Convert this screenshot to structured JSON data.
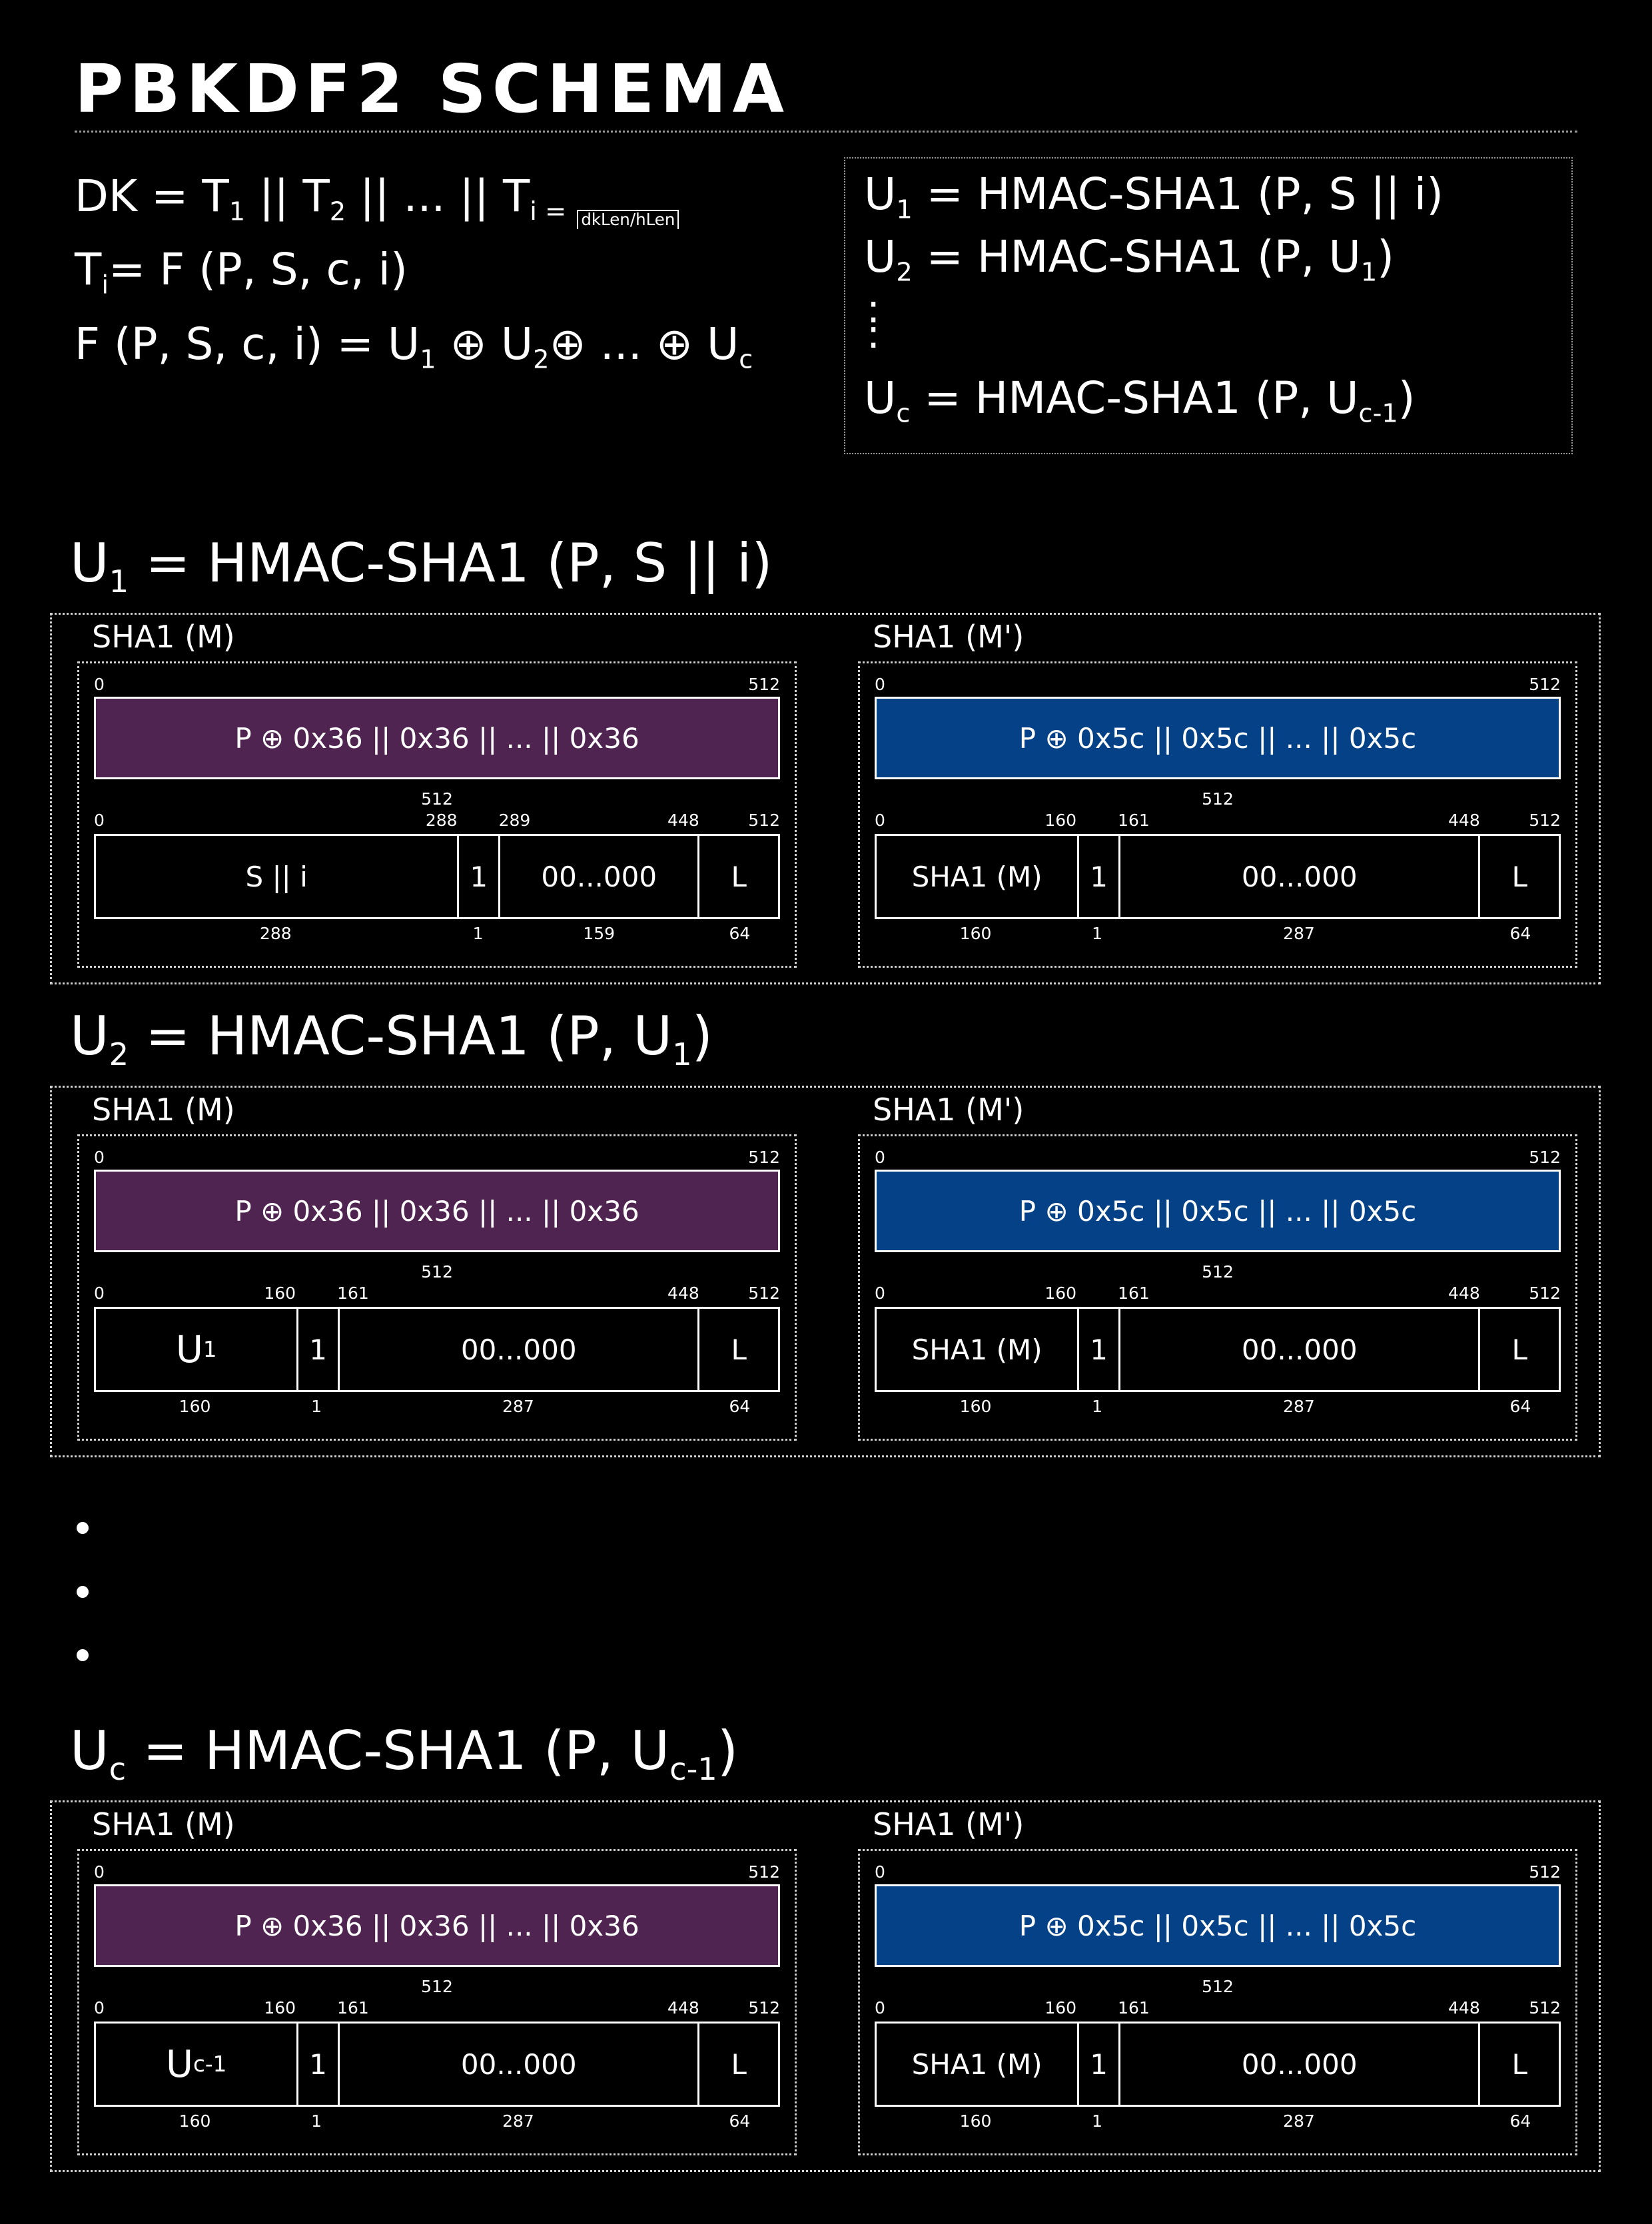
{
  "title": "PBKDF2 SCHEMA",
  "formulas": {
    "dk": {
      "lhs": "DK = T",
      "s1": "1",
      "m1": " || T",
      "s2": "2",
      "m2": " || ... || T",
      "s3": "i = ",
      "ceil": "dkLen/hLen"
    },
    "ti": {
      "a": "T",
      "s1": "i",
      "b": "= F (P, S, c, i)"
    },
    "f": {
      "a": "F (P, S, c, i) = U",
      "s1": "1",
      "b": " ⊕  U",
      "s2": "2",
      "c": "⊕ ... ⊕ U",
      "s3": "c"
    }
  },
  "u_box": {
    "line1": {
      "a": "U",
      "s": "1",
      "b": " = HMAC-SHA1 (P, S || i)"
    },
    "line2": {
      "a": "U",
      "s": "2",
      "b": " = HMAC-SHA1 (P, U",
      "s2": "1",
      "c": ")"
    },
    "dots": ":",
    "line3": {
      "a": "U",
      "s": "c",
      "b": " = HMAC-SHA1 (P, U",
      "s2": "c-1",
      "c": ")"
    }
  },
  "sections": [
    {
      "heading": {
        "a": "U",
        "s": "1",
        "b": " = HMAC-SHA1 (P, S || i)",
        "s2": "",
        "c": ""
      },
      "left": {
        "title": "SHA1 (M)",
        "bar_text": "P ⊕ 0x36 || 0x36 || ... || 0x36",
        "bar_start": "0",
        "bar_end": "512",
        "bar_len": "512",
        "top_ticks": [
          "0",
          "288",
          "289",
          "448",
          "512"
        ],
        "segments": [
          {
            "text": "S || i",
            "sub": ""
          },
          {
            "text": "1",
            "sub": ""
          },
          {
            "text": "00...000",
            "sub": ""
          },
          {
            "text": "L",
            "sub": ""
          }
        ],
        "widths": [
          "288",
          "1",
          "159",
          "64"
        ]
      },
      "right": {
        "title": "SHA1 (M')",
        "bar_text": "P ⊕ 0x5c || 0x5c || ... || 0x5c",
        "bar_start": "0",
        "bar_end": "512",
        "bar_len": "512",
        "top_ticks": [
          "0",
          "160",
          "161",
          "448",
          "512"
        ],
        "segments": [
          {
            "text": "SHA1 (M)",
            "sub": ""
          },
          {
            "text": "1",
            "sub": ""
          },
          {
            "text": "00...000",
            "sub": ""
          },
          {
            "text": "L",
            "sub": ""
          }
        ],
        "widths": [
          "160",
          "1",
          "287",
          "64"
        ]
      }
    },
    {
      "heading": {
        "a": "U",
        "s": "2",
        "b": " = HMAC-SHA1 (P, U",
        "s2": "1",
        "c": ")"
      },
      "left": {
        "title": "SHA1 (M)",
        "bar_text": "P ⊕ 0x36 || 0x36 || ... || 0x36",
        "bar_start": "0",
        "bar_end": "512",
        "bar_len": "512",
        "top_ticks": [
          "0",
          "160",
          "161",
          "448",
          "512"
        ],
        "segments": [
          {
            "text": "U",
            "sub": "1"
          },
          {
            "text": "1",
            "sub": ""
          },
          {
            "text": "00...000",
            "sub": ""
          },
          {
            "text": "L",
            "sub": ""
          }
        ],
        "widths": [
          "160",
          "1",
          "287",
          "64"
        ]
      },
      "right": {
        "title": "SHA1 (M')",
        "bar_text": "P ⊕ 0x5c || 0x5c || ... || 0x5c",
        "bar_start": "0",
        "bar_end": "512",
        "bar_len": "512",
        "top_ticks": [
          "0",
          "160",
          "161",
          "448",
          "512"
        ],
        "segments": [
          {
            "text": "SHA1 (M)",
            "sub": ""
          },
          {
            "text": "1",
            "sub": ""
          },
          {
            "text": "00...000",
            "sub": ""
          },
          {
            "text": "L",
            "sub": ""
          }
        ],
        "widths": [
          "160",
          "1",
          "287",
          "64"
        ]
      }
    },
    {
      "heading": {
        "a": "U",
        "s": "c",
        "b": " = HMAC-SHA1 (P, U",
        "s2": "c-1",
        "c": ")"
      },
      "left": {
        "title": "SHA1 (M)",
        "bar_text": "P ⊕ 0x36 || 0x36 || ... || 0x36",
        "bar_start": "0",
        "bar_end": "512",
        "bar_len": "512",
        "top_ticks": [
          "0",
          "160",
          "161",
          "448",
          "512"
        ],
        "segments": [
          {
            "text": "U",
            "sub": "c-1"
          },
          {
            "text": "1",
            "sub": ""
          },
          {
            "text": "00...000",
            "sub": ""
          },
          {
            "text": "L",
            "sub": ""
          }
        ],
        "widths": [
          "160",
          "1",
          "287",
          "64"
        ]
      },
      "right": {
        "title": "SHA1 (M')",
        "bar_text": "P ⊕ 0x5c || 0x5c || ... || 0x5c",
        "bar_start": "0",
        "bar_end": "512",
        "bar_len": "512",
        "top_ticks": [
          "0",
          "160",
          "161",
          "448",
          "512"
        ],
        "segments": [
          {
            "text": "SHA1 (M)",
            "sub": ""
          },
          {
            "text": "1",
            "sub": ""
          },
          {
            "text": "00...000",
            "sub": ""
          },
          {
            "text": "L",
            "sub": ""
          }
        ],
        "widths": [
          "160",
          "1",
          "287",
          "64"
        ]
      }
    }
  ],
  "colors": {
    "background": "#000000",
    "inner_pad": "#502450",
    "outer_pad": "#044187",
    "border": "#ffffff"
  }
}
